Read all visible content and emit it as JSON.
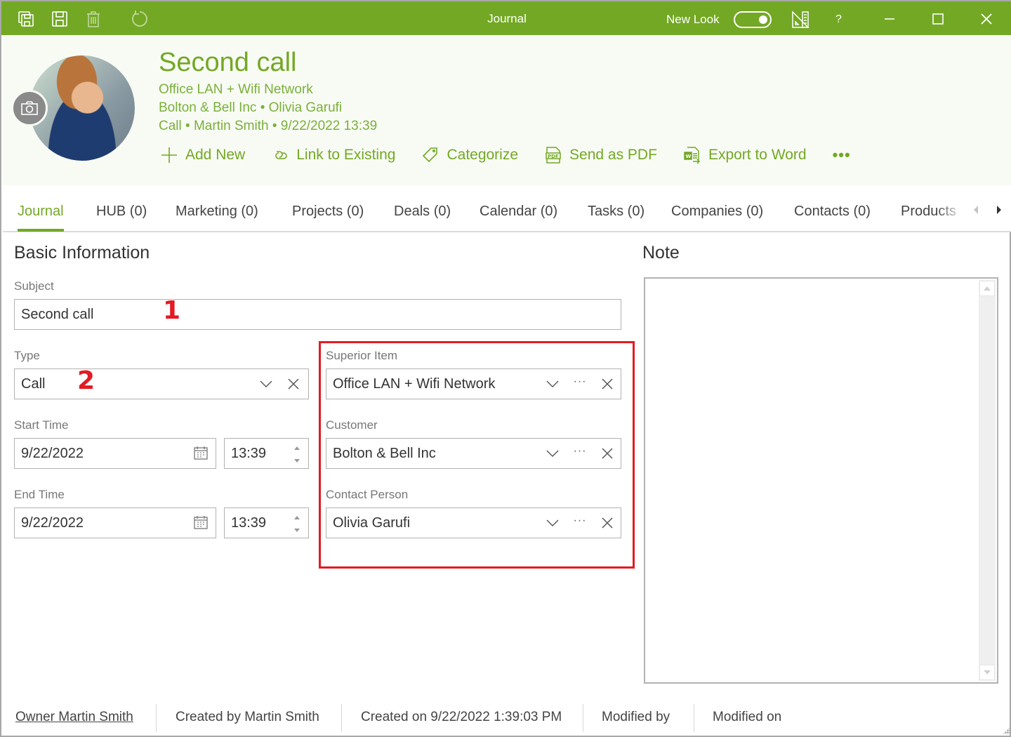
{
  "window": {
    "title": "Journal",
    "new_look_label": "New Look",
    "new_look_on": true,
    "help_label": "?",
    "accent_color": "#73a824",
    "annotation_color": "#e21b23"
  },
  "toolbar": {
    "icons": [
      "save-and-close-icon",
      "save-icon",
      "delete-icon",
      "refresh-icon"
    ]
  },
  "header": {
    "title": "Second call",
    "line1": "Office LAN + Wifi Network",
    "line2": "Bolton & Bell Inc • Olivia Garufi",
    "line3": "Call • Martin Smith • 9/22/2022 13:39",
    "actions": [
      {
        "label": "Add New",
        "icon": "plus-icon"
      },
      {
        "label": "Link to Existing",
        "icon": "link-icon"
      },
      {
        "label": "Categorize",
        "icon": "tag-icon"
      },
      {
        "label": "Send as PDF",
        "icon": "pdf-icon"
      },
      {
        "label": "Export to Word",
        "icon": "word-export-icon"
      }
    ],
    "more_label": "•••"
  },
  "tabs": [
    {
      "label": "Journal",
      "active": true
    },
    {
      "label": "HUB (0)"
    },
    {
      "label": "Marketing (0)"
    },
    {
      "label": "Projects (0)"
    },
    {
      "label": "Deals (0)"
    },
    {
      "label": "Calendar (0)"
    },
    {
      "label": "Tasks (0)"
    },
    {
      "label": "Companies (0)"
    },
    {
      "label": "Contacts (0)"
    },
    {
      "label": "Products"
    }
  ],
  "basic": {
    "title": "Basic Information",
    "subject_label": "Subject",
    "subject_value": "Second call",
    "type_label": "Type",
    "type_value": "Call",
    "start_label": "Start Time",
    "start_date": "9/22/2022",
    "start_time": "13:39",
    "end_label": "End Time",
    "end_date": "9/22/2022",
    "end_time": "13:39"
  },
  "related": {
    "superior_label": "Superior Item",
    "superior_value": "Office LAN + Wifi Network",
    "customer_label": "Customer",
    "customer_value": "Bolton & Bell Inc",
    "contact_label": "Contact Person",
    "contact_value": "Olivia Garufi",
    "more_label": "···"
  },
  "annotations": {
    "marker1": "1",
    "marker2": "2"
  },
  "note": {
    "title": "Note",
    "value": ""
  },
  "footer": {
    "owner": "Owner Martin Smith",
    "created_by": "Created by Martin Smith",
    "created_on": "Created on 9/22/2022 1:39:03 PM",
    "modified_by": "Modified by",
    "modified_on": "Modified on"
  }
}
